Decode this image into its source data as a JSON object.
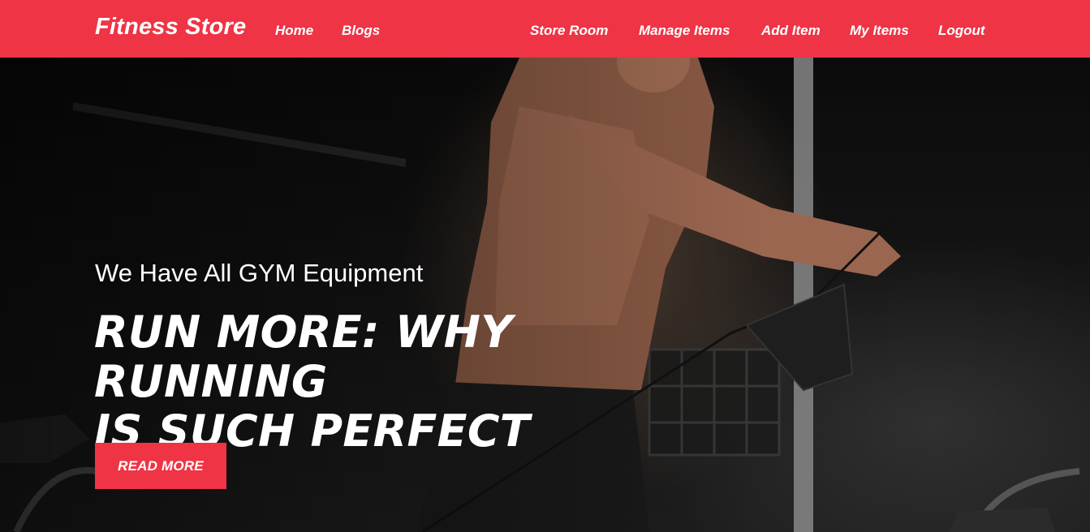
{
  "brand": {
    "name": "Fitness Store"
  },
  "nav": {
    "left": [
      {
        "label": "Home"
      },
      {
        "label": "Blogs"
      }
    ],
    "right": [
      {
        "label": "Store Room"
      },
      {
        "label": "Manage Items"
      },
      {
        "label": "Add Item"
      },
      {
        "label": "My Items"
      },
      {
        "label": "Logout"
      }
    ]
  },
  "hero": {
    "subtitle": "We Have All GYM Equipment",
    "headline_line1": "RUN MORE: WHY RUNNING",
    "headline_line2": "IS SUCH PERFECT",
    "cta_label": "READ MORE",
    "image": "gym-athlete-cable-machine-photo"
  },
  "colors": {
    "accent": "#ee3445",
    "text": "#ffffff",
    "hero_bg": "#111111"
  }
}
